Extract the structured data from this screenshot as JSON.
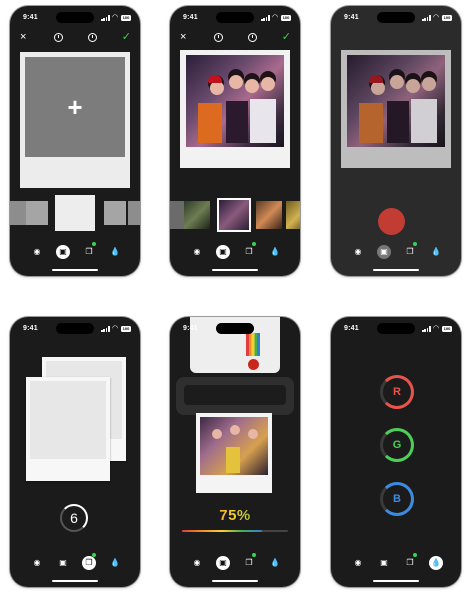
{
  "status_time": "9:41",
  "battery_label": "100",
  "screens": {
    "create_empty": {
      "topbar": {
        "close": "×",
        "confirm": "✓"
      },
      "add_glyph": "+"
    },
    "create_photo": {
      "topbar": {
        "close": "×",
        "confirm": "✓"
      }
    },
    "counter": {
      "value": "6"
    },
    "printing": {
      "percent_label": "75%",
      "progress": 0.75
    },
    "channels": {
      "labels": [
        "R",
        "G",
        "B"
      ],
      "colors": [
        "#e8534a",
        "#4ccf56",
        "#3b8be0"
      ]
    }
  },
  "tabbar_icons": [
    "camera-icon",
    "photo-frame-icon",
    "stack-icon",
    "drop-icon"
  ],
  "colors": {
    "accent_green": "#39d353",
    "shutter_red": "#c13d33",
    "background": "#1b1b1b"
  }
}
